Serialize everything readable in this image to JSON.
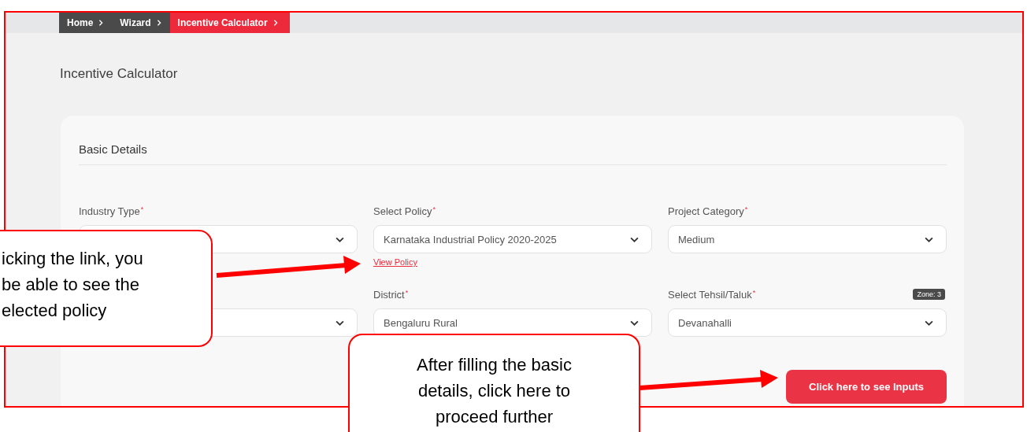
{
  "breadcrumb": [
    {
      "label": "Home",
      "selected": false
    },
    {
      "label": "Wizard",
      "selected": false
    },
    {
      "label": "Incentive Calculator",
      "selected": true
    }
  ],
  "page_title": "Incentive Calculator",
  "section": {
    "title": "Basic Details",
    "fields": [
      {
        "kind": "select",
        "label": "Industry Type",
        "required_mark": "*"
      },
      {
        "kind": "select",
        "label": "Select Policy",
        "required_mark": "*",
        "value": "Karnataka Industrial Policy 2020-2025",
        "link": "View Policy"
      },
      {
        "kind": "select",
        "label": "Project Category",
        "required_mark": "*",
        "value": "Medium"
      },
      {
        "kind": "select"
      },
      {
        "kind": "select",
        "label": "District",
        "required_mark": "*",
        "value": "Bengaluru Rural"
      },
      {
        "kind": "select",
        "label": "Select Tehsil/Taluk",
        "required_mark": "*",
        "value": "Devanahalli",
        "badge": "Zone: 3"
      }
    ],
    "button": "Click here to see Inputs"
  },
  "callouts": [
    {
      "text": "icking the link, you\nbe able to see the\nelected policy",
      "kind": "clipped"
    },
    {
      "text": "After filling the basic\ndetails, click here to\nproceed further",
      "kind": "centered"
    }
  ]
}
